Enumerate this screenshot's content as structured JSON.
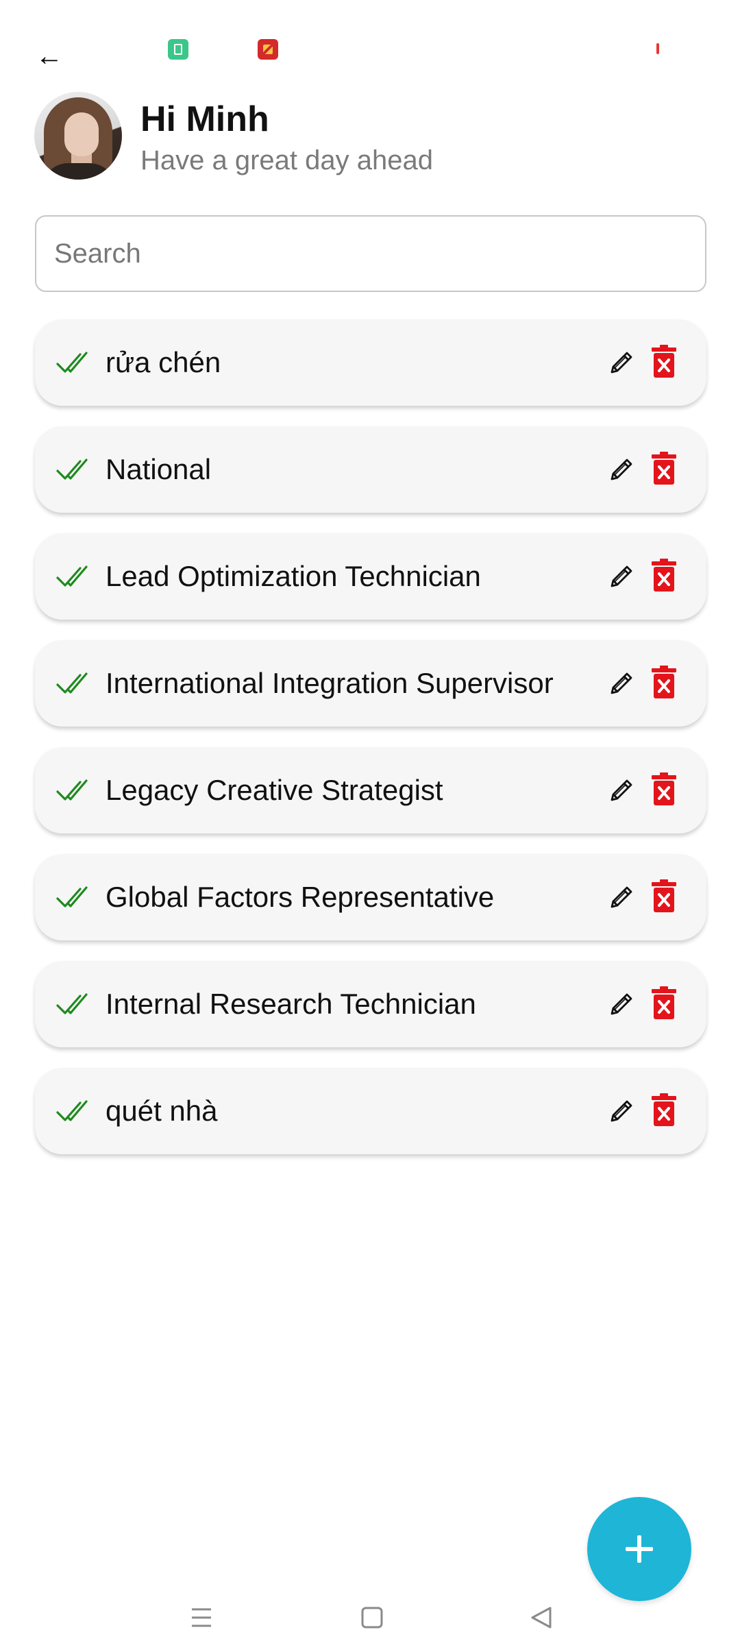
{
  "status_bar": {
    "icons": [
      "back-arrow-icon",
      "battery-app-icon",
      "game-app-icon",
      "notification-dot-icon"
    ],
    "back_glyph": "←"
  },
  "header": {
    "greeting": "Hi Minh",
    "subtitle": "Have a great day ahead",
    "avatar_icon": "user-avatar"
  },
  "search": {
    "placeholder": "Search",
    "value": ""
  },
  "tasks": [
    {
      "title": "rửa chén",
      "done": true
    },
    {
      "title": "National",
      "done": true
    },
    {
      "title": "Lead Optimization Technician",
      "done": true
    },
    {
      "title": "International Integration Supervisor",
      "done": true
    },
    {
      "title": "Legacy Creative Strategist",
      "done": true
    },
    {
      "title": "Global Factors Representative",
      "done": true
    },
    {
      "title": "Internal Research Technician",
      "done": true
    },
    {
      "title": "quét nhà",
      "done": true
    }
  ],
  "task_actions": {
    "edit_icon": "pencil-icon",
    "delete_icon": "trash-delete-icon"
  },
  "fab": {
    "icon": "plus-icon"
  },
  "nav": {
    "icons": [
      "menu-icon",
      "home-square-icon",
      "back-triangle-icon"
    ]
  },
  "colors": {
    "check": "#1e8a1e",
    "delete": "#e3141b",
    "fab": "#1fb5d6",
    "card_bg": "#f6f6f6",
    "subtitle": "#7a7a7a"
  }
}
